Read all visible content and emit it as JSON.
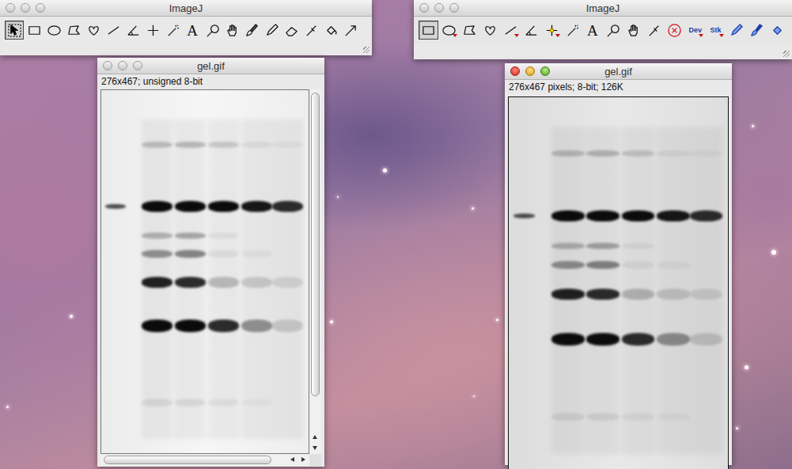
{
  "toolbars": [
    {
      "title": "ImageJ",
      "active": false,
      "tools": [
        {
          "kind": "icon",
          "selected": true,
          "menu": false
        },
        {
          "kind": "icon",
          "selected": false,
          "menu": false
        },
        {
          "kind": "icon",
          "selected": false,
          "menu": false
        },
        {
          "kind": "icon",
          "selected": false,
          "menu": false
        },
        {
          "kind": "icon",
          "selected": false,
          "menu": false
        },
        {
          "kind": "icon",
          "selected": false,
          "menu": false
        },
        {
          "kind": "icon",
          "selected": false,
          "menu": false
        },
        {
          "kind": "icon",
          "selected": false,
          "menu": false
        },
        {
          "kind": "icon",
          "selected": false,
          "menu": false
        },
        {
          "kind": "text",
          "label": "A",
          "selected": false,
          "menu": false
        },
        {
          "kind": "icon",
          "selected": false,
          "menu": false
        },
        {
          "kind": "icon",
          "selected": false,
          "menu": false
        },
        {
          "kind": "icon",
          "selected": false,
          "menu": false
        },
        {
          "kind": "icon",
          "selected": false,
          "menu": false
        },
        {
          "kind": "icon",
          "selected": false,
          "menu": false
        },
        {
          "kind": "icon",
          "selected": false,
          "menu": false
        },
        {
          "kind": "icon",
          "selected": false,
          "menu": false
        },
        {
          "kind": "icon",
          "selected": false,
          "menu": false
        }
      ]
    },
    {
      "title": "ImageJ",
      "active": false,
      "tools": [
        {
          "kind": "icon",
          "selected": true,
          "menu": false
        },
        {
          "kind": "icon",
          "selected": false,
          "menu": true
        },
        {
          "kind": "icon",
          "selected": false,
          "menu": false
        },
        {
          "kind": "icon",
          "selected": false,
          "menu": false
        },
        {
          "kind": "icon",
          "selected": false,
          "menu": true
        },
        {
          "kind": "icon",
          "selected": false,
          "menu": false
        },
        {
          "kind": "icon",
          "selected": false,
          "menu": true
        },
        {
          "kind": "icon",
          "selected": false,
          "menu": false
        },
        {
          "kind": "text",
          "label": "A",
          "selected": false,
          "menu": false
        },
        {
          "kind": "icon",
          "selected": false,
          "menu": false
        },
        {
          "kind": "icon",
          "selected": false,
          "menu": false
        },
        {
          "kind": "icon",
          "selected": false,
          "menu": false
        },
        {
          "kind": "icon",
          "selected": false,
          "menu": false
        },
        {
          "kind": "text",
          "label": "Dev",
          "selected": false,
          "menu": true
        },
        {
          "kind": "text",
          "label": "Stk",
          "selected": false,
          "menu": true
        },
        {
          "kind": "icon",
          "selected": false,
          "menu": false
        },
        {
          "kind": "icon",
          "selected": false,
          "menu": false
        },
        {
          "kind": "icon",
          "selected": false,
          "menu": false
        }
      ]
    }
  ],
  "image_windows": [
    {
      "title": "gel.gif",
      "active": false,
      "info": "276x467; unsigned 8-bit",
      "scrollbars": true,
      "vscroll": 0.9,
      "hscroll": 0.92
    },
    {
      "title": "gel.gif",
      "active": true,
      "info": "276x467 pixels; 8-bit; 126K",
      "scrollbars": false,
      "vscroll": 1,
      "hscroll": 1
    }
  ]
}
